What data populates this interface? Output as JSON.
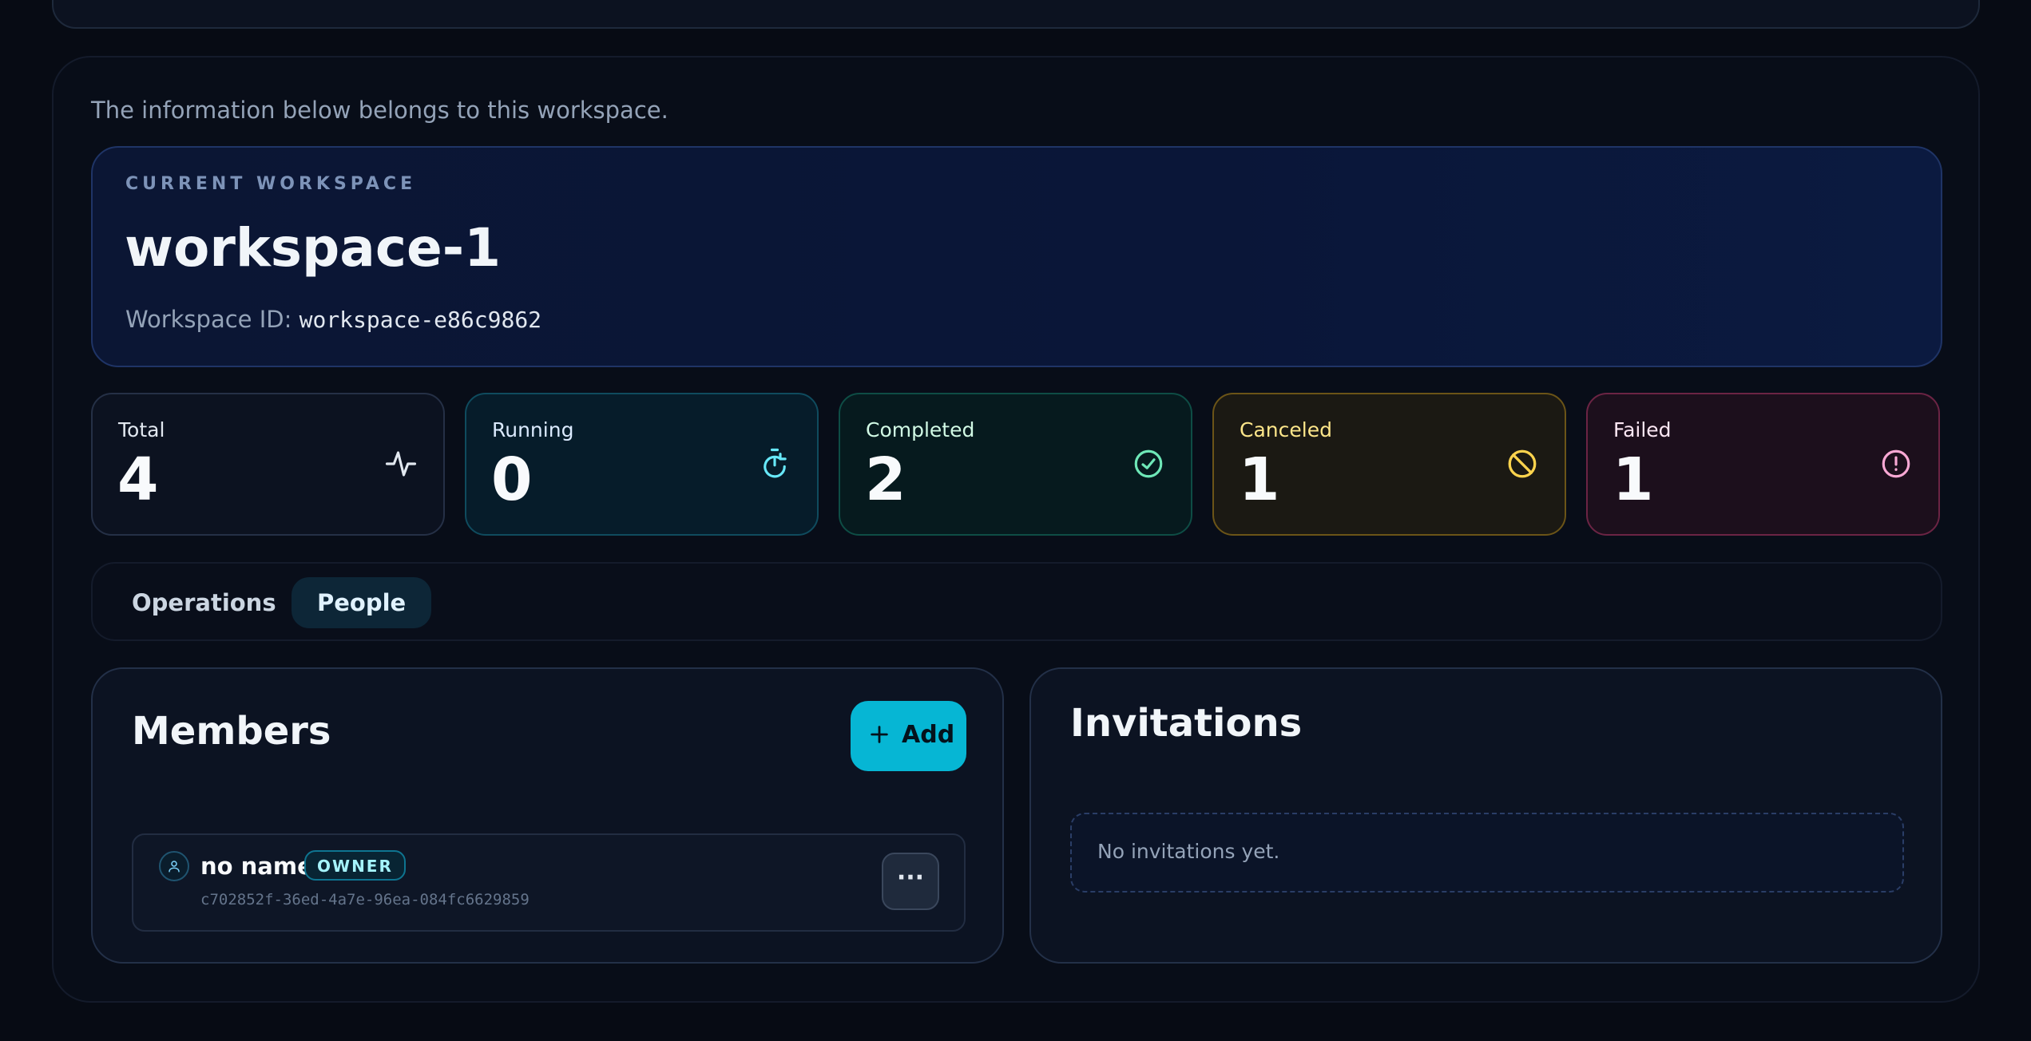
{
  "intro_text": "The information below belongs to this workspace.",
  "workspace": {
    "kicker": "CURRENT WORKSPACE",
    "name": "workspace-1",
    "id_label": "Workspace ID:",
    "id_value": "workspace-e86c9862"
  },
  "stats": {
    "total": {
      "label": "Total",
      "value": "4",
      "icon": "activity-icon",
      "accent": "#e2e8f0"
    },
    "running": {
      "label": "Running",
      "value": "0",
      "icon": "timer-icon",
      "accent": "#67e8f9"
    },
    "completed": {
      "label": "Completed",
      "value": "2",
      "icon": "check-circle-icon",
      "accent": "#6ee7b7"
    },
    "canceled": {
      "label": "Canceled",
      "value": "1",
      "icon": "ban-icon",
      "accent": "#fcd34d"
    },
    "failed": {
      "label": "Failed",
      "value": "1",
      "icon": "alert-circle-icon",
      "accent": "#f9a8d4"
    }
  },
  "tabs": [
    {
      "label": "Operations",
      "active": false
    },
    {
      "label": "People",
      "active": true
    }
  ],
  "members": {
    "title": "Members",
    "add_label": "Add",
    "items": [
      {
        "name": "no name",
        "role": "OWNER",
        "id": "c702852f-36ed-4a7e-96ea-084fc6629859",
        "more_label": "···"
      }
    ]
  },
  "invitations": {
    "title": "Invitations",
    "empty_text": "No invitations yet."
  },
  "colors": {
    "background": "#070b14",
    "accent": "#06b6d4"
  }
}
